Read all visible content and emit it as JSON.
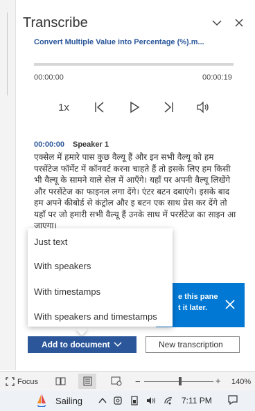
{
  "pane": {
    "title": "Transcribe",
    "file_name": "Convert Multiple Value into Percentage (%).m...",
    "time_start": "00:00:00",
    "time_end": "00:00:19",
    "progress": 0,
    "speed": "1x"
  },
  "transcript": {
    "timestamp": "00:00:00",
    "speaker": "Speaker 1",
    "text": "एक्सेल में हमारे पास कुछ वैल्यू हैं और इन सभी वैल्यू को हम परसेंटेज फॉर्मेट में कॉनवर्ट करना चाहते हैं तो इसके लिए हम किसी भी वैल्यू के सामने वाले सेल में आएँगे। यहाँ पर अपनी वैल्यू लिखेंगे और परसेंटेज का फाइनल लगा देंगे। एंटर बटन दबाएंगे। इसके बाद हम अपने कीबोर्ड से कंट्रोल और इ बटन एक साथ प्रेस कर देंगे तो यहाँ पर जो हमारी सभी वैल्यू हैं उनके साथ में परसेंटेज का साइन आ जाएगा।"
  },
  "menu": {
    "items": [
      "Just text",
      "With speakers",
      "With timestamps",
      "With speakers and timestamps"
    ]
  },
  "notification": {
    "text_line1": "e this pane",
    "text_line2": "t it later."
  },
  "buttons": {
    "add_to_document": "Add to document",
    "new_transcription": "New transcription"
  },
  "statusbar": {
    "focus": "Focus",
    "zoom_minus": "−",
    "zoom_plus": "+",
    "zoom_level": "140%"
  },
  "taskbar": {
    "app_label": "Sailing",
    "clock": "7:11 PM"
  },
  "colors": {
    "accent": "#2b579a",
    "notification_bg": "#0078d4"
  }
}
